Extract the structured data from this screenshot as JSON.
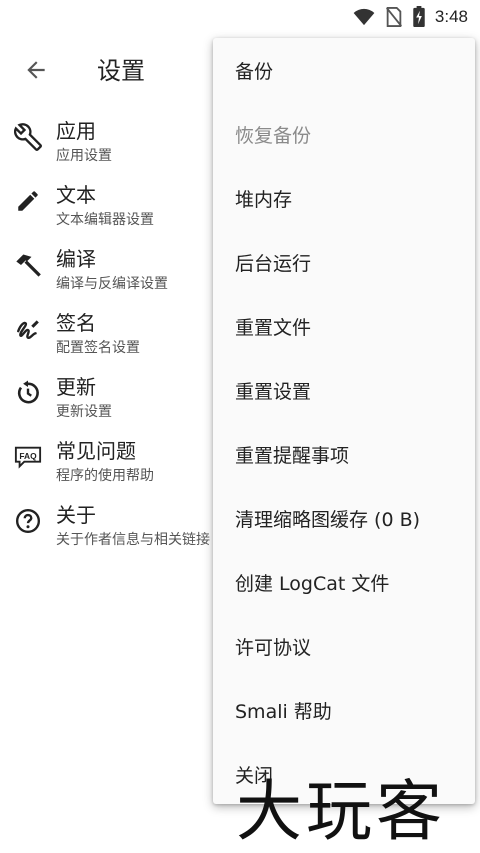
{
  "status_bar": {
    "time": "3:48",
    "icons": [
      "wifi-icon",
      "no-sim-icon",
      "battery-charging-icon"
    ]
  },
  "toolbar": {
    "title": "设置",
    "back_icon": "arrow-left-icon"
  },
  "settings": [
    {
      "title": "应用",
      "subtitle": "应用设置",
      "icon": "wrench-icon"
    },
    {
      "title": "文本",
      "subtitle": "文本编辑器设置",
      "icon": "pencil-icon"
    },
    {
      "title": "编译",
      "subtitle": "编译与反编译设置",
      "icon": "hammer-icon"
    },
    {
      "title": "签名",
      "subtitle": "配置签名设置",
      "icon": "signature-icon"
    },
    {
      "title": "更新",
      "subtitle": "更新设置",
      "icon": "update-icon"
    },
    {
      "title": "常见问题",
      "subtitle": "程序的使用帮助",
      "icon": "faq-icon"
    },
    {
      "title": "关于",
      "subtitle": "关于作者信息与相关链接",
      "icon": "help-circle-icon"
    }
  ],
  "menu": [
    {
      "label": "备份",
      "enabled": true
    },
    {
      "label": "恢复备份",
      "enabled": false
    },
    {
      "label": "堆内存",
      "enabled": true
    },
    {
      "label": "后台运行",
      "enabled": true
    },
    {
      "label": "重置文件",
      "enabled": true
    },
    {
      "label": "重置设置",
      "enabled": true
    },
    {
      "label": "重置提醒事项",
      "enabled": true
    },
    {
      "label": "清理缩略图缓存 (0 B)",
      "enabled": true
    },
    {
      "label": "创建 LogCat 文件",
      "enabled": true
    },
    {
      "label": "许可协议",
      "enabled": true
    },
    {
      "label": "Smali 帮助",
      "enabled": true
    },
    {
      "label": "关闭",
      "enabled": true
    }
  ],
  "watermark": {
    "text": "大玩客"
  }
}
